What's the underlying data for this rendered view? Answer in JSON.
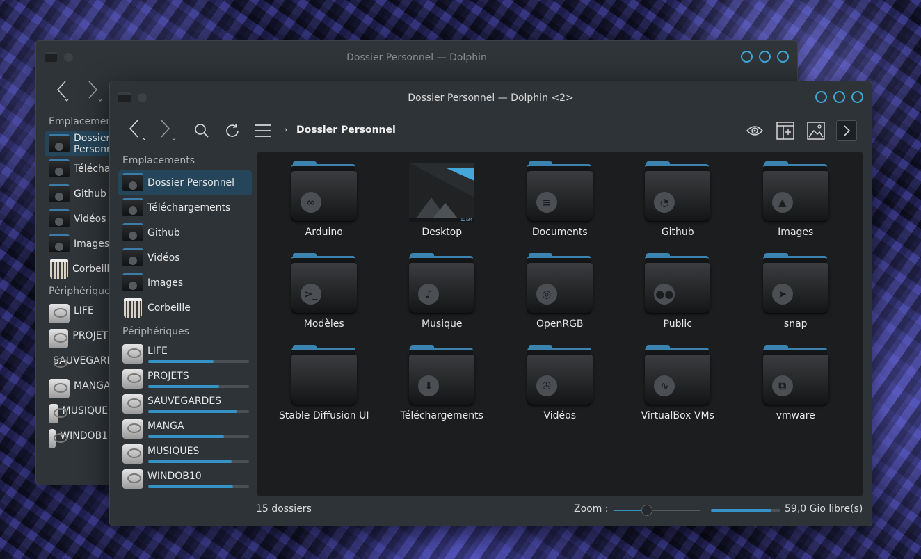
{
  "back_window": {
    "title": "Dossier Personnel — Dolphin",
    "places_header": "Emplacements",
    "places": [
      "Dossier Personnel",
      "Téléchargements",
      "Github",
      "Vidéos",
      "Images",
      "Corbeille"
    ],
    "devices_header": "Périphériques",
    "devices": [
      "LIFE",
      "PROJETS",
      "SAUVEGARDES",
      "MANGA",
      "MUSIQUES",
      "WINDOB10"
    ]
  },
  "front_window": {
    "title": "Dossier Personnel — Dolphin <2>",
    "breadcrumb": "Dossier Personnel",
    "sidebar": {
      "places_header": "Emplacements",
      "places": [
        {
          "label": "Dossier Personnel",
          "icon": "home-folder-icon",
          "active": true
        },
        {
          "label": "Téléchargements",
          "icon": "downloads-folder-icon",
          "active": false
        },
        {
          "label": "Github",
          "icon": "github-folder-icon",
          "active": false
        },
        {
          "label": "Vidéos",
          "icon": "videos-folder-icon",
          "active": false
        },
        {
          "label": "Images",
          "icon": "images-folder-icon",
          "active": false
        },
        {
          "label": "Corbeille",
          "icon": "trash-icon",
          "active": false
        }
      ],
      "devices_header": "Périphériques",
      "devices": [
        {
          "label": "LIFE",
          "usage": 0.65
        },
        {
          "label": "PROJETS",
          "usage": 0.7
        },
        {
          "label": "SAUVEGARDES",
          "usage": 0.88
        },
        {
          "label": "MANGA",
          "usage": 0.75
        },
        {
          "label": "MUSIQUES",
          "usage": 0.83
        },
        {
          "label": "WINDOB10",
          "usage": 0.84
        }
      ]
    },
    "folders": [
      {
        "name": "Arduino",
        "emblem": "∞"
      },
      {
        "name": "Desktop",
        "emblem": "desktop"
      },
      {
        "name": "Documents",
        "emblem": "≡"
      },
      {
        "name": "Github",
        "emblem": "◔"
      },
      {
        "name": "Images",
        "emblem": "▲"
      },
      {
        "name": "Modèles",
        "emblem": ">_"
      },
      {
        "name": "Musique",
        "emblem": "♪"
      },
      {
        "name": "OpenRGB",
        "emblem": "◎"
      },
      {
        "name": "Public",
        "emblem": "●●"
      },
      {
        "name": "snap",
        "emblem": "➤"
      },
      {
        "name": "Stable Diffusion UI",
        "emblem": ""
      },
      {
        "name": "Téléchargements",
        "emblem": "⬇"
      },
      {
        "name": "Vidéos",
        "emblem": "✇"
      },
      {
        "name": "VirtualBox VMs",
        "emblem": "∿"
      },
      {
        "name": "vmware",
        "emblem": "⧉"
      }
    ],
    "desktop_thumb_clock": "12:34",
    "status": {
      "count": "15 dossiers",
      "zoom_label": "Zoom :",
      "zoom_level": 0.38,
      "free_space_text": "59,0 Gio libre(s)",
      "used_fraction": 0.87
    }
  },
  "colors": {
    "accent": "#3592c4",
    "window_bg": "#2e3337",
    "view_bg": "#1b1d1f",
    "active_item": "#25455a"
  }
}
